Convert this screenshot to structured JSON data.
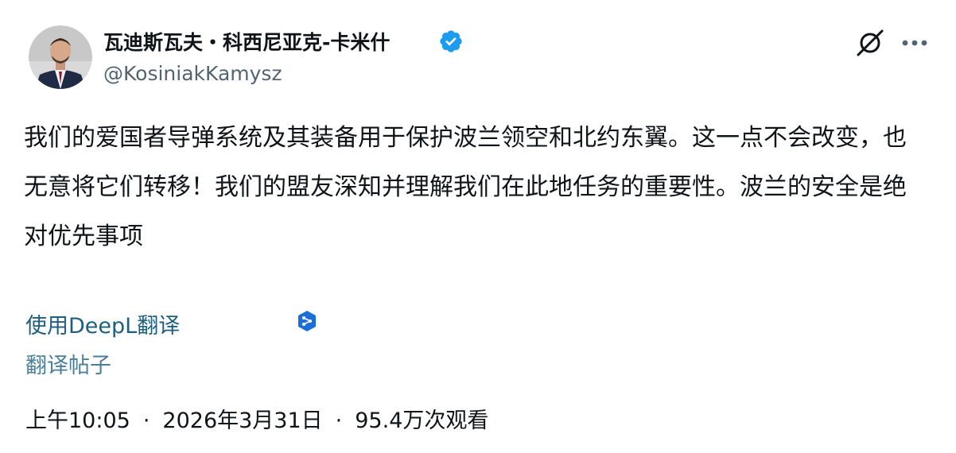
{
  "tweet": {
    "author": {
      "display_name": "瓦迪斯瓦夫・科西尼亚克-卡米什",
      "handle": "@KosiniakKamysz",
      "verified_icon": "verified-badge-icon",
      "verified_color": "#1d9bf0"
    },
    "actions": {
      "grok_icon": "grok-icon",
      "more_icon": "more-dots-icon"
    },
    "text": "我们的爱国者导弹系统及其装备用于保护波兰领空和北约东翼。这一点不会改变，也无意将它们转移！我们的盟友深知并理解我们在此地任务的重要性。波兰的安全是绝对优先事项",
    "translate": {
      "deepl_label": "使用DeepL翻译",
      "deepl_icon": "deepl-icon",
      "post_label": "翻译帖子"
    },
    "meta": {
      "time": "上午10:05",
      "separator": "·",
      "date": "2026年3月31日",
      "views": "95.4万次观看"
    }
  }
}
